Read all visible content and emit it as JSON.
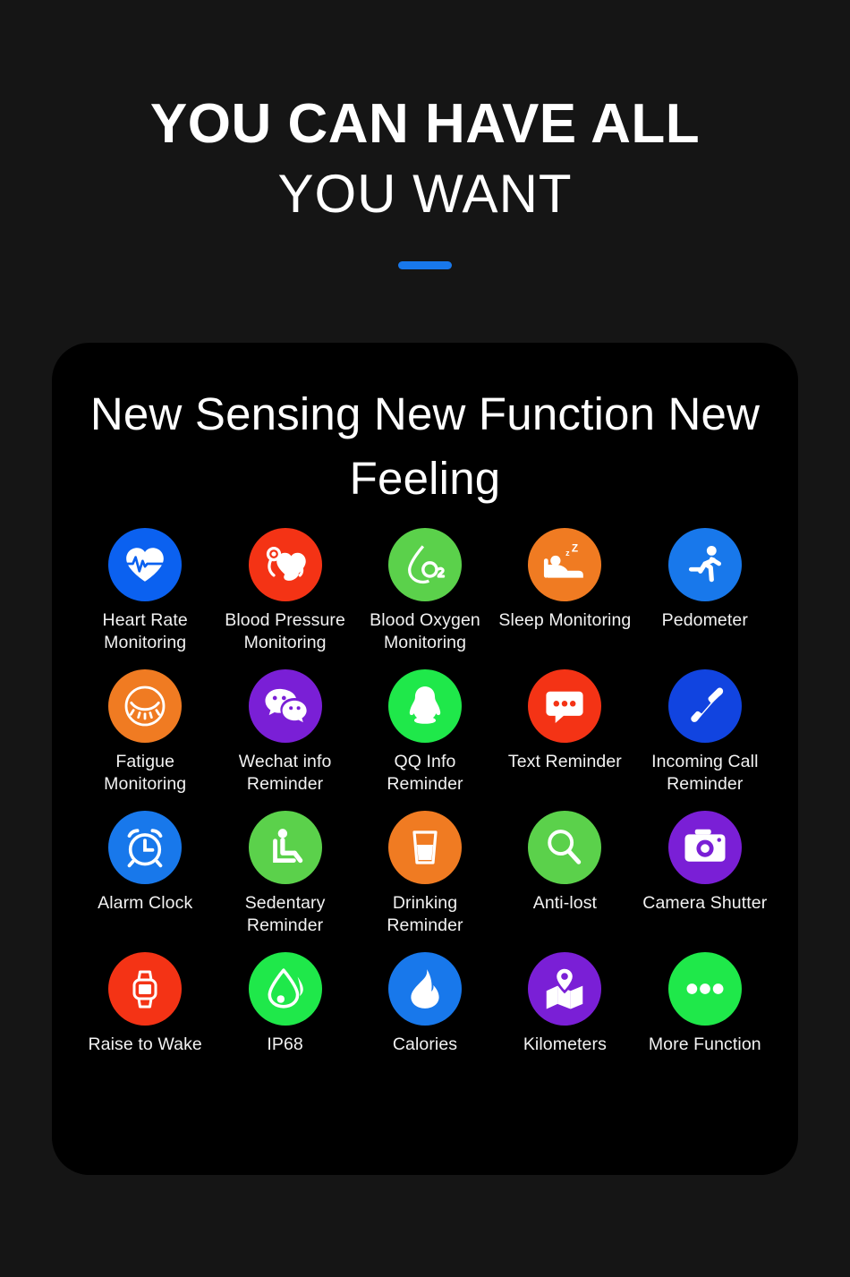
{
  "hero": {
    "line1": "YOU CAN HAVE ALL",
    "line2": "YOU WANT",
    "accent_color": "#1878EB"
  },
  "card": {
    "title": "New Sensing New Function\nNew Feeling",
    "background": "#000000"
  },
  "palette": {
    "blue": "#0B61F0",
    "bright_blue": "#1878EB",
    "red": "#F43315",
    "orange": "#F07B22",
    "green": "#5BD14B",
    "bright_green": "#1FE84A",
    "purple": "#7A1FD6",
    "page_background": "#151515"
  },
  "features": [
    {
      "label": "Heart Rate\nMonitoring",
      "icon": "heart-pulse-icon",
      "color": "#0B61F0"
    },
    {
      "label": "Blood Pressure\nMonitoring",
      "icon": "blood-pressure-cuff-icon",
      "color": "#F43315"
    },
    {
      "label": "Blood Oxygen\nMonitoring",
      "icon": "oxygen-droplet-icon",
      "color": "#5BD14B"
    },
    {
      "label": "Sleep Monitoring",
      "icon": "bed-sleep-icon",
      "color": "#F07B22"
    },
    {
      "label": "Pedometer",
      "icon": "running-person-icon",
      "color": "#1878EB"
    },
    {
      "label": "Fatigue\nMonitoring",
      "icon": "closed-eye-icon",
      "color": "#F07B22"
    },
    {
      "label": "Wechat info\nReminder",
      "icon": "wechat-bubbles-icon",
      "color": "#7A1FD6"
    },
    {
      "label": "QQ Info\nReminder",
      "icon": "qq-penguin-icon",
      "color": "#1FE84A"
    },
    {
      "label": "Text Reminder",
      "icon": "message-bubble-icon",
      "color": "#F43315"
    },
    {
      "label": "Incoming Call\nReminder",
      "icon": "phone-handset-icon",
      "color": "#1144E0"
    },
    {
      "label": "Alarm Clock",
      "icon": "alarm-clock-icon",
      "color": "#1878EB"
    },
    {
      "label": "Sedentary\nReminder",
      "icon": "seated-person-icon",
      "color": "#5BD14B"
    },
    {
      "label": "Drinking Reminder",
      "icon": "water-glass-icon",
      "color": "#F07B22"
    },
    {
      "label": "Anti-lost",
      "icon": "magnifier-icon",
      "color": "#5BD14B"
    },
    {
      "label": "Camera Shutter",
      "icon": "camera-icon",
      "color": "#7A1FD6"
    },
    {
      "label": "Raise to Wake",
      "icon": "smartwatch-icon",
      "color": "#F43315"
    },
    {
      "label": "IP68",
      "icon": "water-droplet-icon",
      "color": "#1FE84A"
    },
    {
      "label": "Calories",
      "icon": "flame-icon",
      "color": "#1878EB"
    },
    {
      "label": "Kilometers",
      "icon": "map-pin-icon",
      "color": "#7A1FD6"
    },
    {
      "label": "More Function",
      "icon": "three-dots-icon",
      "color": "#1FE84A"
    }
  ]
}
